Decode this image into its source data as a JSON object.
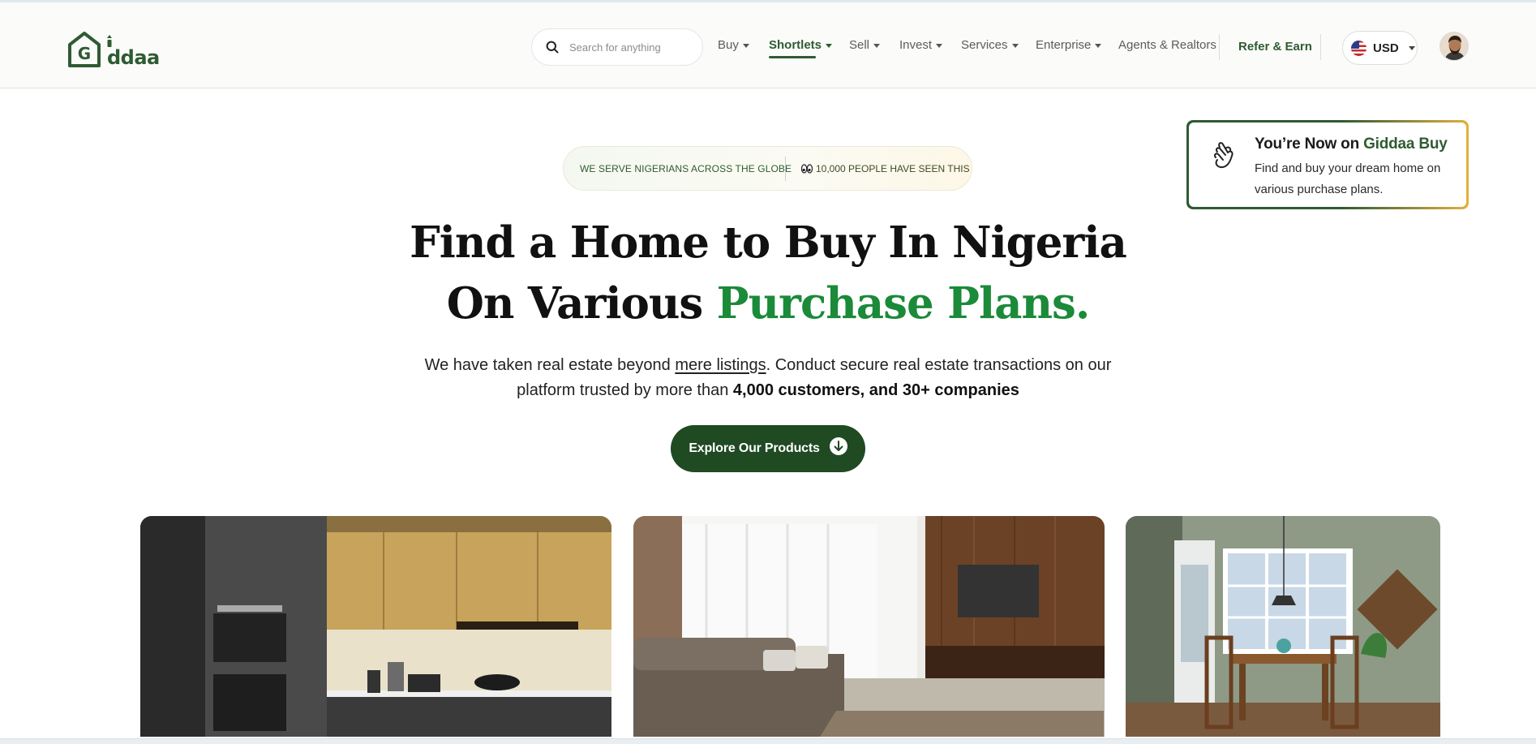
{
  "brand": {
    "logo_text": "ddaa",
    "accent": "#2f5b32",
    "highlight": "#1b8a39"
  },
  "search": {
    "placeholder": "Search for anything",
    "icon": "search-icon"
  },
  "nav": {
    "items": [
      {
        "label": "Buy",
        "dropdown": true
      },
      {
        "label": "Shortlets",
        "dropdown": true,
        "active": true
      },
      {
        "label": "Sell",
        "dropdown": true
      },
      {
        "label": "Invest",
        "dropdown": true
      },
      {
        "label": "Services",
        "dropdown": true
      },
      {
        "label": "Enterprise",
        "dropdown": true
      },
      {
        "label": "Agents & Realtors",
        "dropdown": false
      }
    ],
    "refer_label": "Refer & Earn",
    "currency": "USD"
  },
  "toast": {
    "title_prefix": "You’re Now on ",
    "title_highlight": "Giddaa Buy",
    "body": "Find and buy your dream home on various purchase plans.",
    "icon": "hand-wave-icon"
  },
  "hero": {
    "pill_left": "WE SERVE NIGERIANS ACROSS THE GLOBE",
    "pill_right": "10,000 PEOPLE HAVE SEEN THIS",
    "headline_line1": "Find a Home to Buy In Nigeria",
    "headline_line2_plain": "On Various ",
    "headline_line2_highlight": "Purchase Plans.",
    "sub_line1_a": "We have taken real estate beyond ",
    "sub_line1_link": "mere listings",
    "sub_line1_b": ". Conduct secure real estate transactions on our",
    "sub_line2_a": "platform trusted by more than ",
    "sub_line2_bold": "4,000 customers, and 30+ companies",
    "cta_label": "Explore Our Products"
  },
  "gallery": [
    {
      "subject": "kitchen"
    },
    {
      "subject": "living room"
    },
    {
      "subject": "dining nook"
    }
  ]
}
